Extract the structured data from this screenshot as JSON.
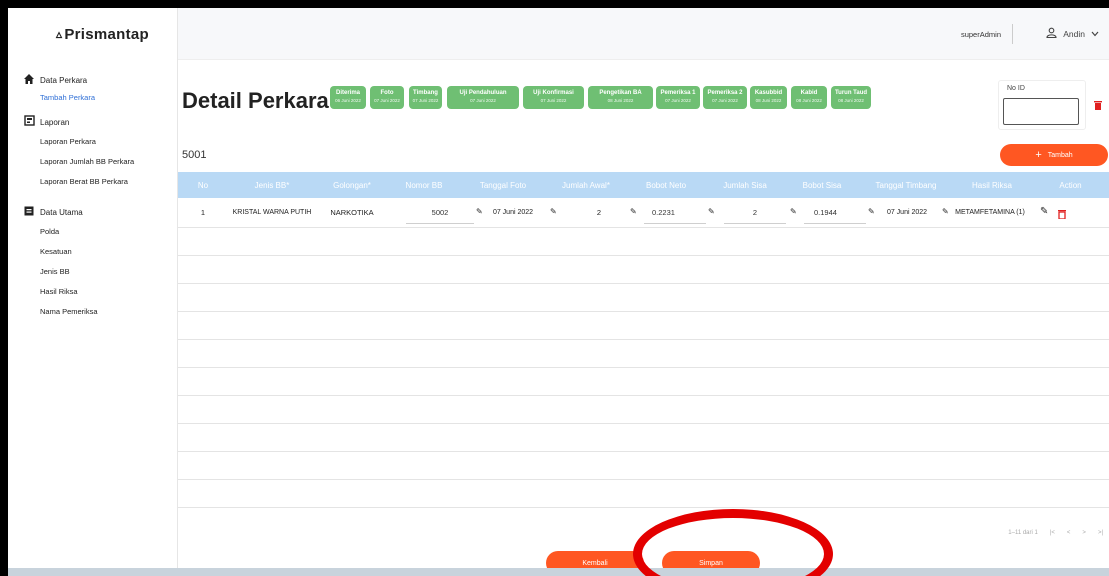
{
  "brand": {
    "logo_mark": "▵",
    "name": "Prismantap"
  },
  "sidebar": {
    "groups": [
      {
        "icon": "home-icon",
        "label": "Data Perkara",
        "items": [
          {
            "label": "Tambah Perkara",
            "active": true
          }
        ]
      },
      {
        "icon": "report-icon",
        "label": "Laporan",
        "items": [
          {
            "label": "Laporan Perkara"
          },
          {
            "label": "Laporan Jumlah BB Perkara"
          },
          {
            "label": "Laporan Berat BB Perkara"
          }
        ]
      },
      {
        "icon": "database-icon",
        "label": "Data Utama",
        "items": [
          {
            "label": "Polda"
          },
          {
            "label": "Kesatuan"
          },
          {
            "label": "Jenis BB"
          },
          {
            "label": "Hasil Riksa"
          },
          {
            "label": "Nama Pemeriksa"
          }
        ]
      }
    ]
  },
  "topbar": {
    "role": "superAdmin",
    "user": "Andin"
  },
  "page": {
    "title": "Detail Perkara",
    "case_number": "5001",
    "no_id_label": "No ID",
    "add_button": "Tambah"
  },
  "stages": [
    {
      "label": "Diterima",
      "date": "06 Juni 2022"
    },
    {
      "label": "Foto",
      "date": "07 Juni 2022"
    },
    {
      "label": "Timbang",
      "date": "07 Juni 2022"
    },
    {
      "label": "Uji Pendahuluan",
      "date": "07 Juni 2022"
    },
    {
      "label": "Uji Konfirmasi",
      "date": "07 Juni 2022"
    },
    {
      "label": "Pengetikan BA",
      "date": "08 Juni 2022"
    },
    {
      "label": "Pemeriksa 1",
      "date": "07 Juni 2022"
    },
    {
      "label": "Pemeriksa 2",
      "date": "07 Juni 2022"
    },
    {
      "label": "Kasubbid",
      "date": "08 Juni 2022"
    },
    {
      "label": "Kabid",
      "date": "08 Juni 2022"
    },
    {
      "label": "Turun Taud",
      "date": "08 Juni 2022"
    }
  ],
  "table": {
    "columns": [
      "No",
      "Jenis BB*",
      "Golongan*",
      "Nomor BB",
      "Tanggal Foto",
      "Jumlah Awal*",
      "Bobot Neto",
      "Jumlah Sisa",
      "Bobot Sisa",
      "Tanggal Timbang",
      "Hasil Riksa",
      "Action"
    ],
    "rows": [
      {
        "no": "1",
        "jenis_bb": "KRISTAL WARNA PUTIH",
        "golongan": "NARKOTIKA",
        "nomor_bb": "5002",
        "tanggal_foto": "07 Juni 2022",
        "jumlah_awal": "2",
        "bobot_neto": "0.2231",
        "jumlah_sisa": "2",
        "bobot_sisa": "0.1944",
        "tanggal_timbang": "07 Juni 2022",
        "hasil_riksa": "METAMFETAMINA (1)"
      }
    ]
  },
  "pagination": {
    "range": "1–11 dari 1",
    "first": "|<",
    "prev": "<",
    "next": ">",
    "last": ">|"
  },
  "footer": {
    "back_button": "Kembali",
    "save_button": "Simpan"
  },
  "colors": {
    "stage": "#6fbf73",
    "accent": "#ff5722",
    "header": "#b9d9f5",
    "danger": "#e02020",
    "annotation": "#e30000"
  }
}
